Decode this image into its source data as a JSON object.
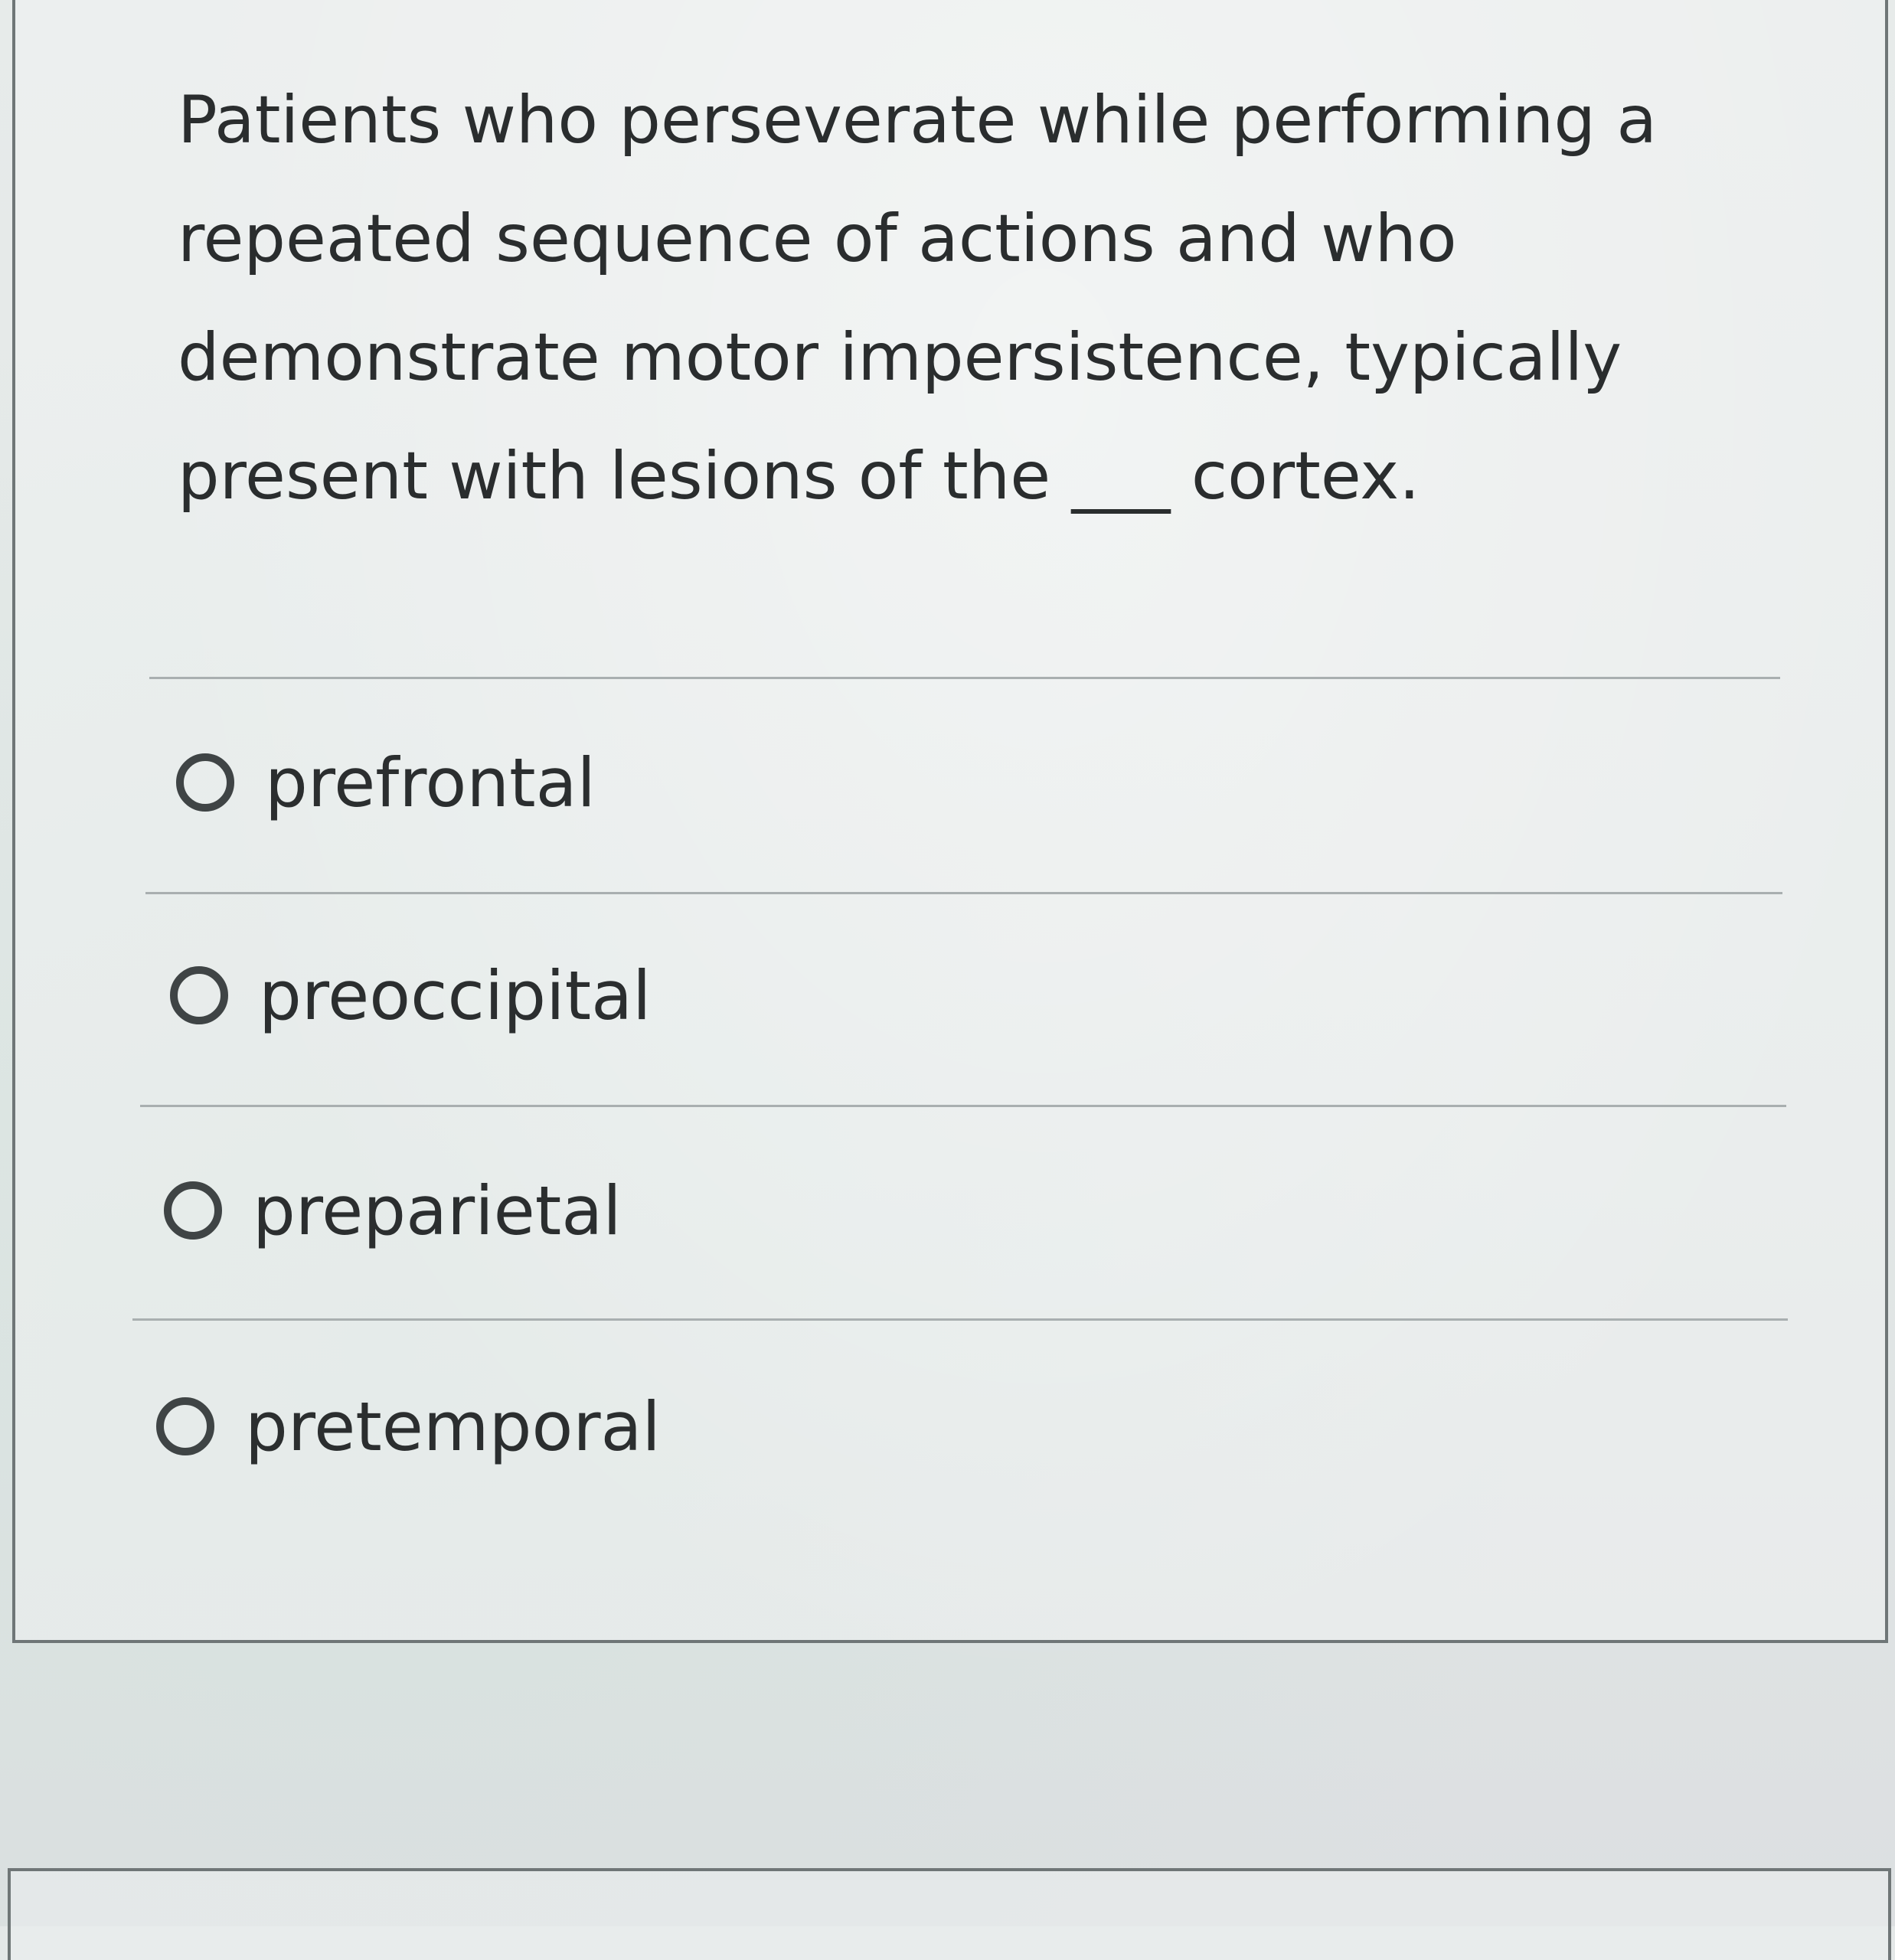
{
  "question": {
    "text": "Patients who perseverate while performing a repeated sequence of actions and who demonstrate motor impersistence, typically present with lesions of the ___ cortex."
  },
  "options": [
    {
      "label": "prefrontal"
    },
    {
      "label": "preoccipital"
    },
    {
      "label": "preparietal"
    },
    {
      "label": "pretemporal"
    }
  ]
}
